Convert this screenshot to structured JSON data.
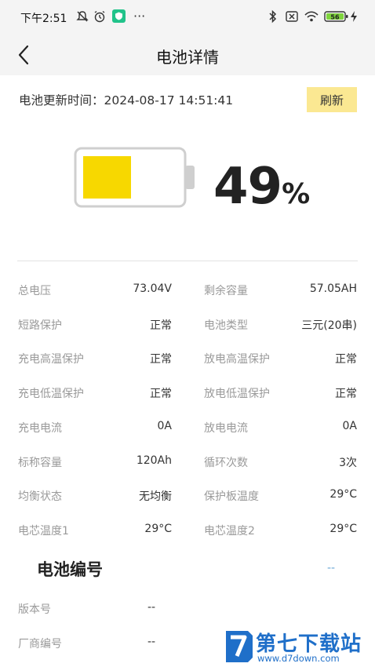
{
  "status_bar": {
    "time": "下午2:51",
    "battery_level": "56",
    "icons": [
      "silent-icon",
      "alarm-icon",
      "app-badge-icon",
      "more-dots-icon",
      "bluetooth-icon",
      "sim-off-icon",
      "wifi-icon",
      "battery-icon",
      "charging-icon"
    ]
  },
  "header": {
    "title": "电池详情"
  },
  "update": {
    "label": "电池更新时间：2024-08-17 14:51:41",
    "refresh_label": "刷新"
  },
  "battery": {
    "percent_value": "49",
    "percent_sign": "%",
    "fill_fraction": 0.49,
    "fill_color": "#f7d800"
  },
  "details": [
    [
      {
        "label": "总电压",
        "value": "73.04V"
      },
      {
        "label": "剩余容量",
        "value": "57.05AH"
      }
    ],
    [
      {
        "label": "短路保护",
        "value": "正常"
      },
      {
        "label": "电池类型",
        "value": "三元(20串)"
      }
    ],
    [
      {
        "label": "充电高温保护",
        "value": "正常"
      },
      {
        "label": "放电高温保护",
        "value": "正常"
      }
    ],
    [
      {
        "label": "充电低温保护",
        "value": "正常"
      },
      {
        "label": "放电低温保护",
        "value": "正常"
      }
    ],
    [
      {
        "label": "充电电流",
        "value": "0A"
      },
      {
        "label": "放电电流",
        "value": "0A"
      }
    ],
    [
      {
        "label": "标称容量",
        "value": "120Ah"
      },
      {
        "label": "循环次数",
        "value": "3次"
      }
    ],
    [
      {
        "label": "均衡状态",
        "value": "无均衡"
      },
      {
        "label": "保护板温度",
        "value": "29°C"
      }
    ],
    [
      {
        "label": "电芯温度1",
        "value": "29°C"
      },
      {
        "label": "电芯温度2",
        "value": "29°C"
      }
    ]
  ],
  "serial": {
    "title": "电池编号",
    "value": "--"
  },
  "versions": [
    {
      "label": "版本号",
      "value": "--"
    },
    {
      "label": "厂商编号",
      "value": "--"
    }
  ],
  "watermark": {
    "title": "第七下载站",
    "url": "www.d7down.com"
  }
}
